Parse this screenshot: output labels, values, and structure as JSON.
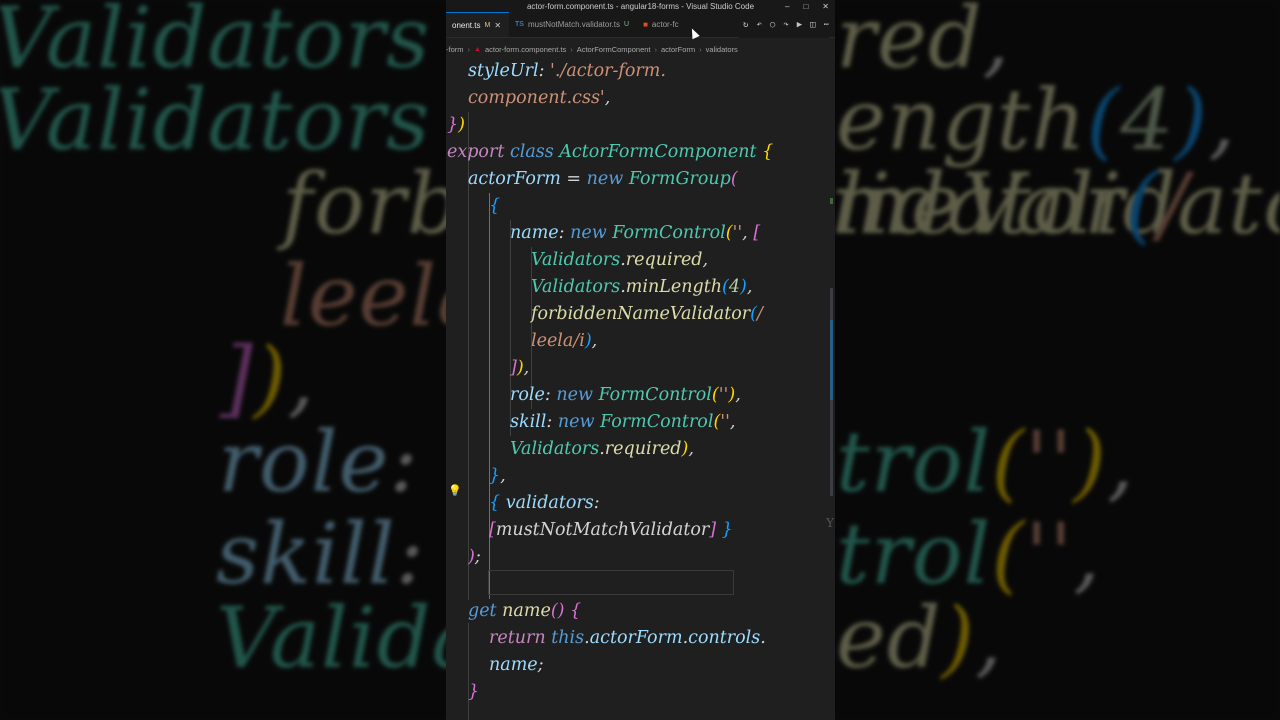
{
  "window": {
    "title": "actor-form.component.ts - angular18-forms - Visual Studio Code"
  },
  "tabs": [
    {
      "label": "onent.ts",
      "badge": "M",
      "icon": "ts",
      "active": true
    },
    {
      "label": "mustNotMatch.validator.ts",
      "badge": "U",
      "icon": "ts",
      "active": false
    },
    {
      "label": "actor-fc",
      "badge": "",
      "icon": "html5",
      "active": false
    }
  ],
  "breadcrumb": [
    "-form",
    "actor-form.component.ts",
    "ActorFormComponent",
    "actorForm",
    "validators"
  ],
  "code": {
    "l1": {
      "a": "styleUrl",
      "b": ": ",
      "c": "'./actor-form."
    },
    "l2": {
      "a": "component.css'",
      "b": ","
    },
    "l3": {
      "a": "}",
      "b": ")"
    },
    "l4": {
      "a": "export",
      "b": " class ",
      "c": "ActorFormComponent",
      "d": " {"
    },
    "l5": {
      "a": "actorForm",
      "b": " = ",
      "c": "new",
      "d": " FormGroup",
      "e": "("
    },
    "l6": {
      "a": "{"
    },
    "l7": {
      "a": "name",
      "b": ": ",
      "c": "new",
      "d": " FormControl",
      "e": "(",
      "f": "''",
      "g": ", ",
      "h": "["
    },
    "l8": {
      "a": "Validators",
      "b": ".",
      "c": "required",
      "d": ","
    },
    "l9": {
      "a": "Validators",
      "b": ".",
      "c": "minLength",
      "d": "(",
      "e": "4",
      "f": ")",
      "g": ","
    },
    "l10": {
      "a": "forbiddenNameValidator",
      "b": "(",
      "c": "/"
    },
    "l11": {
      "a": "leela",
      "b": "/i",
      "c": ")",
      "d": ","
    },
    "l12": {
      "a": "]",
      "b": ")",
      "c": ","
    },
    "l13": {
      "a": "role",
      "b": ": ",
      "c": "new",
      "d": " FormControl",
      "e": "(",
      "f": "''",
      "g": ")",
      "h": ","
    },
    "l14": {
      "a": "skill",
      "b": ": ",
      "c": "new",
      "d": " FormControl",
      "e": "(",
      "f": "''",
      "g": ","
    },
    "l15": {
      "a": "Validators",
      "b": ".",
      "c": "required",
      "d": ")",
      "e": ","
    },
    "l16": {
      "a": "}",
      "b": ","
    },
    "l17": {
      "a": "{",
      "b": " validators",
      "c": ":"
    },
    "l18": {
      "a": "[",
      "b": "mustNotMatchValidator",
      "c": "]",
      "d": " }"
    },
    "l19": {
      "a": ")",
      "b": ";"
    },
    "l20": {
      "a": "get",
      "b": " name",
      "c": "()",
      "d": " {"
    },
    "l21": {
      "a": "return",
      "b": " this",
      "c": ".",
      "d": "actorForm",
      "e": ".",
      "f": "controls",
      "g": "."
    },
    "l22": {
      "a": "name",
      "b": ";"
    },
    "l23": {
      "a": "}"
    }
  },
  "ghost_text": "Y",
  "colors": {
    "editor_bg": "#1f1f1f",
    "keyword": "#569cd6",
    "control": "#c586c0",
    "class": "#4ec9b0",
    "property": "#9cdcfe",
    "function": "#dcdcaa",
    "string": "#ce9178"
  }
}
